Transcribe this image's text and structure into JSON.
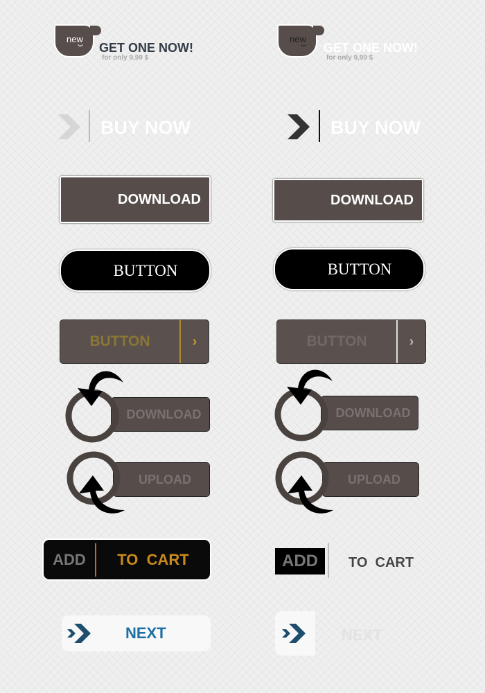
{
  "promo": {
    "badge": "new",
    "title": "GET ONE NOW!",
    "subtitle": "for only 9,99 $"
  },
  "buy_now": {
    "label": "BUY NOW"
  },
  "download": {
    "label": "DOWNLOAD"
  },
  "button": {
    "label": "BUTTON"
  },
  "arrow_button": {
    "label": "BUTTON",
    "arrow": "›"
  },
  "circle_download": {
    "label": "DOWNLOAD"
  },
  "circle_upload": {
    "label": "UPLOAD"
  },
  "add_to_cart": {
    "add": "ADD",
    "to_cart": "TO  CART"
  },
  "next": {
    "label": "NEXT"
  },
  "colors": {
    "brown": "#564d4a",
    "gold": "#c98a1c",
    "blue": "#1a6fa3",
    "black": "#000000"
  }
}
